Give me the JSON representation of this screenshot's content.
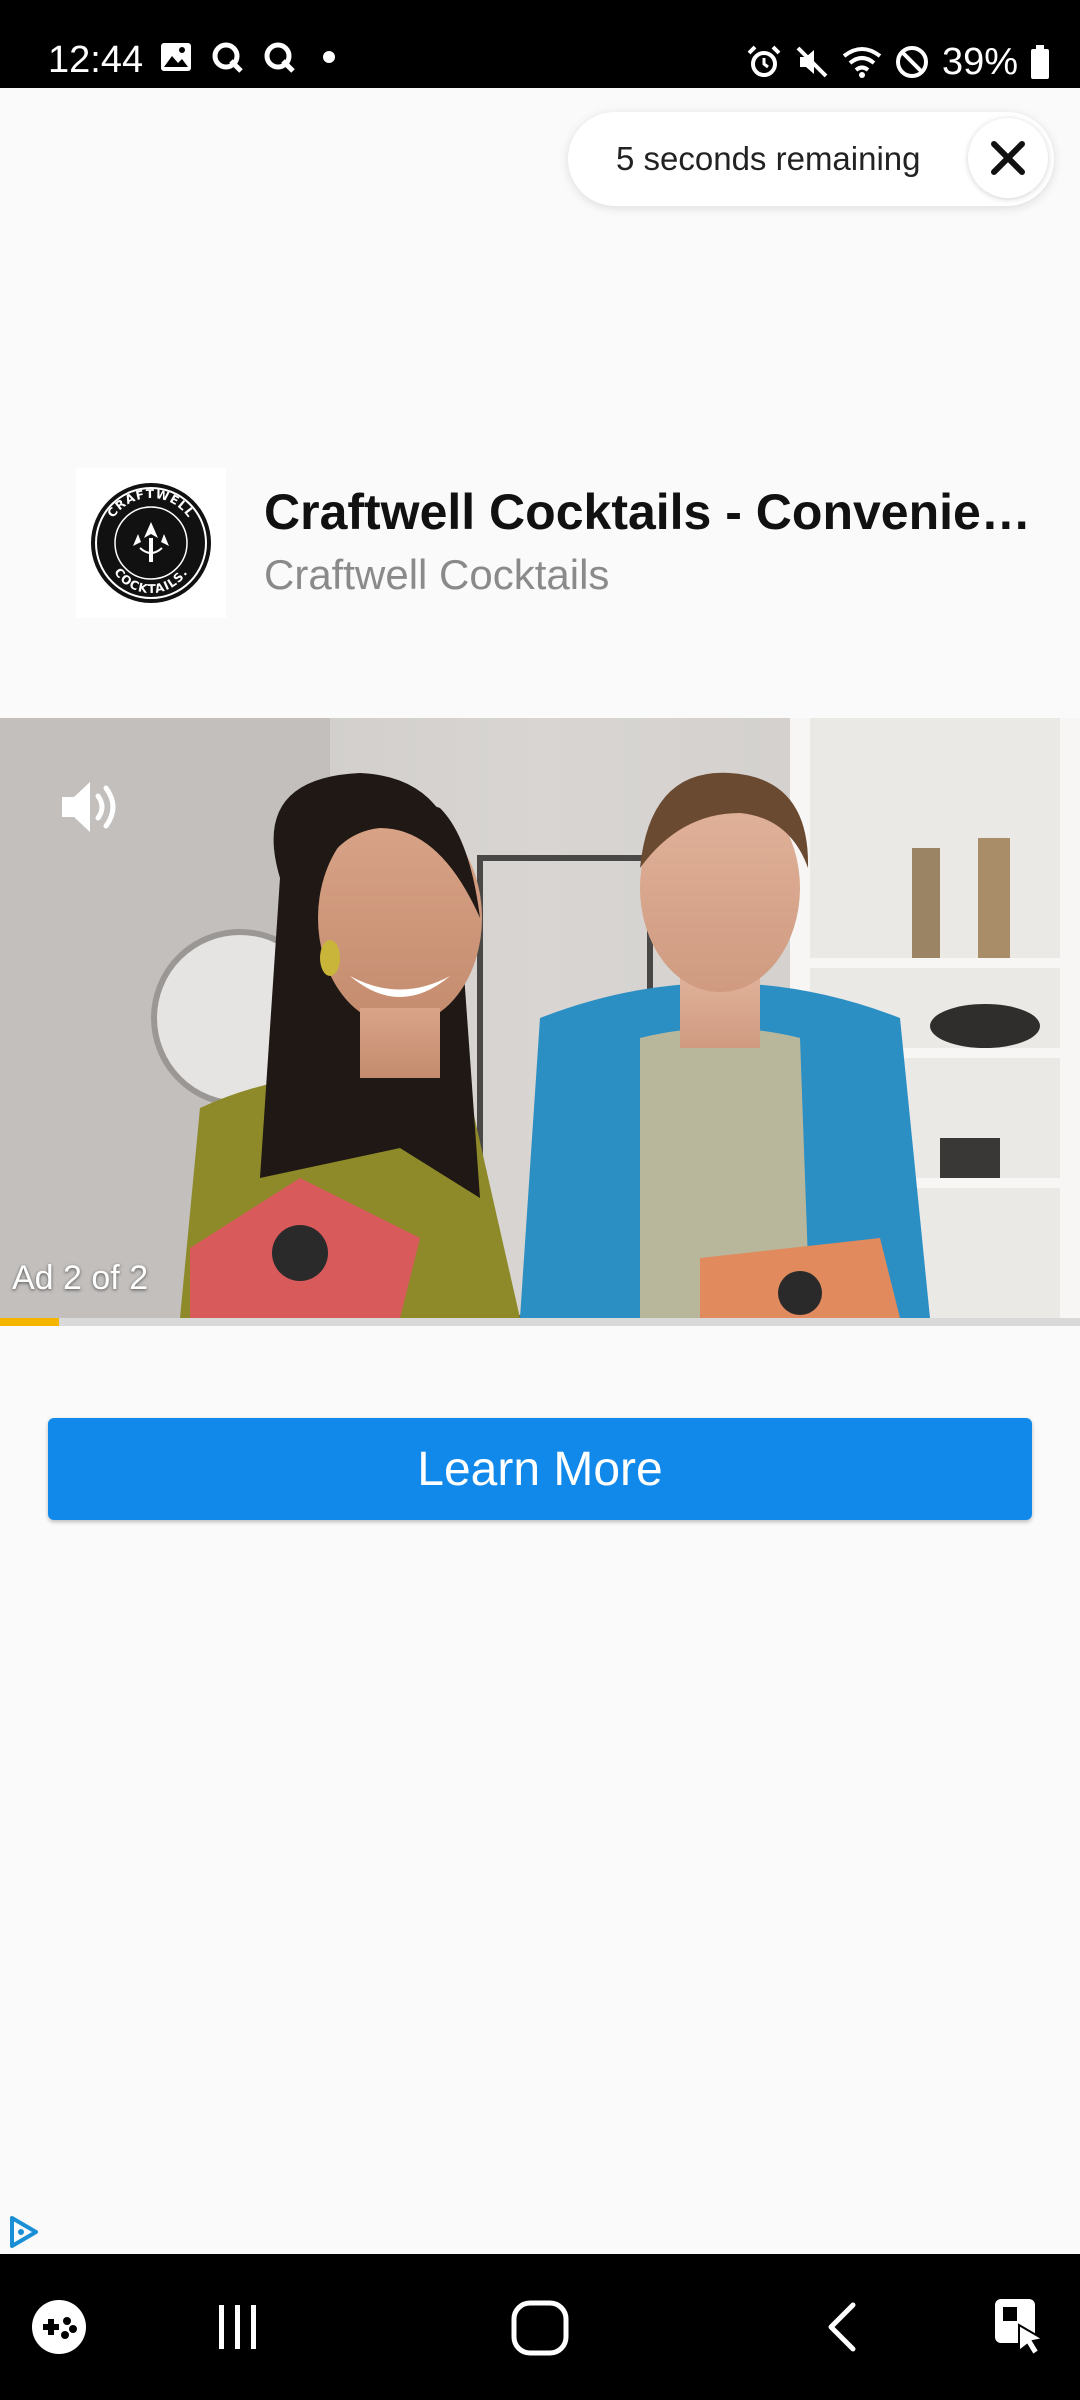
{
  "status_bar": {
    "time": "12:44",
    "battery": "39%",
    "left_icons": [
      "image-icon",
      "q-icon",
      "q-icon",
      "dot-icon"
    ],
    "right_icons": [
      "alarm-icon",
      "mute-icon",
      "wifi-icon",
      "do-not-disturb-icon",
      "battery-icon"
    ]
  },
  "timer": {
    "text": "5 seconds remaining"
  },
  "advertiser": {
    "logo_text_top": "CRAFTWELL",
    "logo_text_bottom": "COCKTAILS.",
    "title": "Craftwell Cocktails - Convenient…",
    "name": "Craftwell Cocktails"
  },
  "video": {
    "counter": "Ad 2 of 2",
    "progress": 0.055
  },
  "cta": {
    "label": "Learn More"
  },
  "colors": {
    "cta": "#1189ea",
    "progress": "#f5b400",
    "subtitle": "#8a8a8a"
  },
  "nav_bar": {
    "items": [
      "game-launcher-icon",
      "recent-apps-icon",
      "home-icon",
      "back-icon",
      "screen-assist-icon"
    ]
  }
}
